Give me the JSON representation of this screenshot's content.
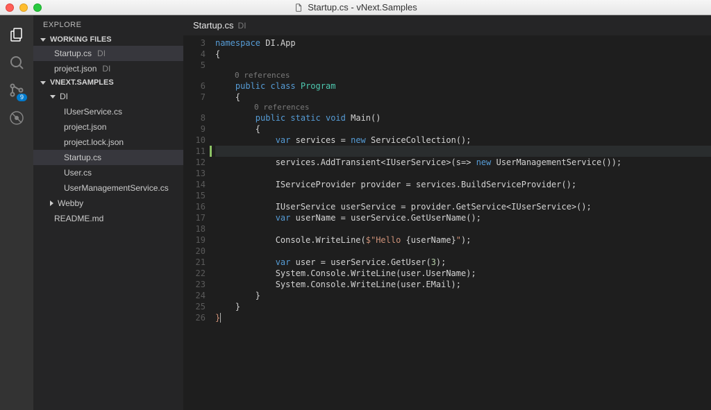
{
  "window": {
    "filename": "Startup.cs",
    "project": "vNext.Samples"
  },
  "activity": {
    "git_badge": "9"
  },
  "sidebar": {
    "title": "EXPLORE",
    "sections": {
      "working_files": {
        "label": "WORKING FILES",
        "items": [
          {
            "name": "Startup.cs",
            "suffix": "DI"
          },
          {
            "name": "project.json",
            "suffix": "DI"
          }
        ]
      },
      "project": {
        "label": "VNEXT.SAMPLES",
        "folders": [
          {
            "name": "DI",
            "files": [
              "IUserService.cs",
              "project.json",
              "project.lock.json",
              "Startup.cs",
              "User.cs",
              "UserManagementService.cs"
            ]
          },
          {
            "name": "Webby"
          }
        ],
        "root_files": [
          "README.md"
        ]
      }
    }
  },
  "editor": {
    "tab": {
      "name": "Startup.cs",
      "suffix": "DI"
    },
    "codelens": "0 references",
    "lines": {
      "l3": {
        "n": "3",
        "html": "<span class='kw'>namespace</span> DI.App"
      },
      "l4": {
        "n": "4",
        "html": "{"
      },
      "l5": {
        "n": "5",
        "html": ""
      },
      "lc1": {
        "html": "    0 references",
        "codelens": true
      },
      "l6": {
        "n": "6",
        "html": "    <span class='kw'>public</span> <span class='kw'>class</span> <span class='type'>Program</span>"
      },
      "l7": {
        "n": "7",
        "html": "    {"
      },
      "lc2": {
        "html": "        0 references",
        "codelens": true
      },
      "l8": {
        "n": "8",
        "html": "        <span class='kw'>public</span> <span class='kw'>static</span> <span class='kw'>void</span> Main()"
      },
      "l9": {
        "n": "9",
        "html": "        {"
      },
      "l10": {
        "n": "10",
        "html": "            <span class='kw'>var</span> services = <span class='kw'>new</span> ServiceCollection();"
      },
      "l11": {
        "n": "11",
        "html": "",
        "highlight": true,
        "insertMark": true
      },
      "l12": {
        "n": "12",
        "html": "            services.AddTransient&lt;IUserService&gt;(s=&gt; <span class='kw'>new</span> UserManagementService());"
      },
      "l13": {
        "n": "13",
        "html": ""
      },
      "l14": {
        "n": "14",
        "html": "            IServiceProvider provider = services.BuildServiceProvider();"
      },
      "l15": {
        "n": "15",
        "html": ""
      },
      "l16": {
        "n": "16",
        "html": "            IUserService userService = provider.GetService&lt;IUserService&gt;();"
      },
      "l17": {
        "n": "17",
        "html": "            <span class='kw'>var</span> userName = userService.GetUserName();"
      },
      "l18": {
        "n": "18",
        "html": ""
      },
      "l19": {
        "n": "19",
        "html": "            Console.WriteLine(<span class='str'>$&quot;Hello </span>{userName}<span class='str'>&quot;</span>);"
      },
      "l20": {
        "n": "20",
        "html": ""
      },
      "l21": {
        "n": "21",
        "html": "            <span class='kw'>var</span> user = userService.GetUser(<span class='num'>3</span>);"
      },
      "l22": {
        "n": "22",
        "html": "            System.Console.WriteLine(user.UserName);"
      },
      "l23": {
        "n": "23",
        "html": "            System.Console.WriteLine(user.EMail);"
      },
      "l24": {
        "n": "24",
        "html": "        }"
      },
      "l25": {
        "n": "25",
        "html": "    }"
      },
      "l26": {
        "n": "26",
        "html": "<span style='color:#ce9178'>}</span><span class='cursor'></span>"
      }
    },
    "lineOrder": [
      "l3",
      "l4",
      "l5",
      "lc1",
      "l6",
      "l7",
      "lc2",
      "l8",
      "l9",
      "l10",
      "l11",
      "l12",
      "l13",
      "l14",
      "l15",
      "l16",
      "l17",
      "l18",
      "l19",
      "l20",
      "l21",
      "l22",
      "l23",
      "l24",
      "l25",
      "l26"
    ]
  }
}
